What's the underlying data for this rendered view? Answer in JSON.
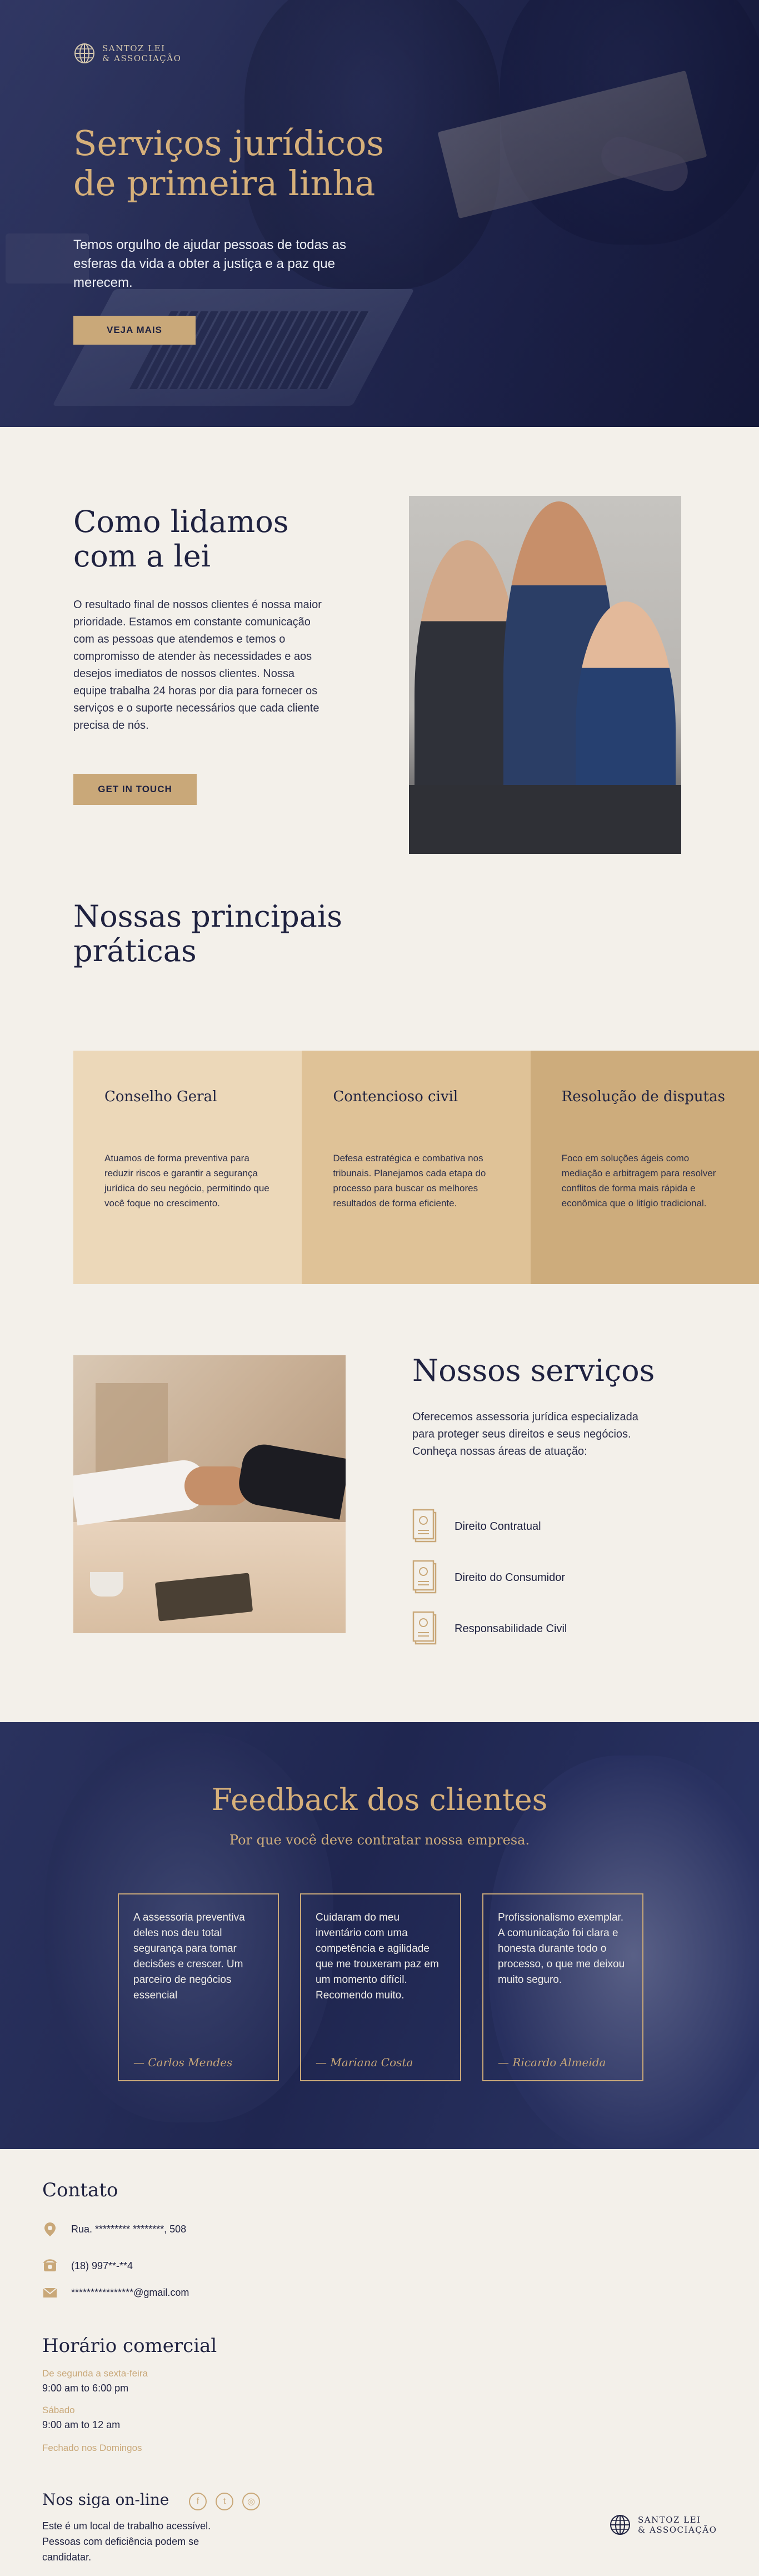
{
  "brand": {
    "line1": "SANTOZ LEI",
    "line2": "& ASSOCIAÇÃO"
  },
  "hero": {
    "title": "Serviços jurídicos de primeira linha",
    "subtitle": "Temos orgulho de ajudar pessoas de todas as esferas da vida a obter a justiça e a paz que merecem.",
    "button": "VEJA MAIS"
  },
  "how": {
    "title": "Como lidamos com a lei",
    "text": "O resultado final de nossos clientes é nossa maior prioridade. Estamos em constante comunicação com as pessoas que atendemos e temos o compromisso de atender às necessidades e aos desejos imediatos de nossos clientes. Nossa equipe trabalha 24 horas por dia para fornecer os serviços e o suporte necessários que cada cliente precisa de nós.",
    "button": "GET IN TOUCH"
  },
  "practices": {
    "title": "Nossas principais práticas",
    "cards": [
      {
        "title": "Conselho Geral",
        "text": "Atuamos de forma preventiva para reduzir riscos e garantir a segurança jurídica do seu negócio, permitindo que você foque no crescimento.",
        "color": "#ecd8b9"
      },
      {
        "title": "Contencioso civil",
        "text": "Defesa estratégica e combativa nos tribunais. Planejamos cada etapa do processo para buscar os melhores resultados de forma eficiente.",
        "color": "#dfc297"
      },
      {
        "title": "Resolução de disputas",
        "text": "Foco em soluções ágeis como mediação e arbitragem para resolver conflitos de forma mais rápida e econômica que o litígio tradicional.",
        "color": "#cdac7c"
      }
    ]
  },
  "services": {
    "title": "Nossos serviços",
    "text": "Oferecemos assessoria jurídica especializada para proteger seus direitos e seus negócios. Conheça nossas áreas de atuação:",
    "items": [
      "Direito Contratual",
      "Direito do Consumidor",
      "Responsabilidade Civil"
    ]
  },
  "feedback": {
    "title": "Feedback dos clientes",
    "subtitle": "Por que você deve contratar nossa empresa.",
    "items": [
      {
        "text": "A assessoria preventiva deles nos deu total segurança para tomar decisões e crescer. Um parceiro de negócios essencial",
        "author": "— Carlos Mendes"
      },
      {
        "text": "Cuidaram do meu inventário com uma competência e agilidade que me trouxeram paz em um momento difícil. Recomendo muito.",
        "author": "— Mariana Costa"
      },
      {
        "text": "Profissionalismo exemplar. A comunicação foi clara e honesta durante todo o processo, o que me deixou muito seguro.",
        "author": "— Ricardo Almeida"
      }
    ]
  },
  "contact": {
    "title": "Contato",
    "address": "Rua. ********* ********, 508",
    "phone": "(18) 997**-**4",
    "email": "****************@gmail.com"
  },
  "hours": {
    "title": "Horário comercial",
    "weekday_label": "De segunda a sexta-feira",
    "weekday_value": "9:00 am to 6:00 pm",
    "saturday_label": "Sábado",
    "saturday_value": "9:00 am to 12 am",
    "sunday_label": "Fechado nos Domingos"
  },
  "social": {
    "title": "Nos siga on-line",
    "note": "Este é um local de trabalho acessível. Pessoas com deficiência podem se candidatar."
  },
  "colors": {
    "navy": "#1f2240",
    "gold": "#c9a879",
    "cream": "#f3f0ea"
  }
}
